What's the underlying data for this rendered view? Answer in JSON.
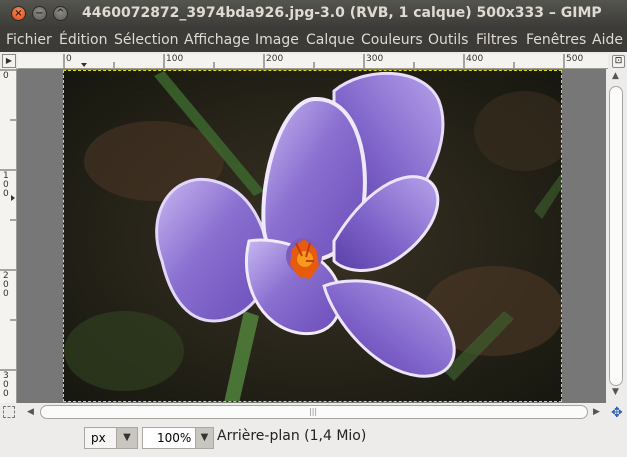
{
  "window": {
    "title": "4460072872_3974bda926.jpg-3.0 (RVB, 1 calque) 500x333 – GIMP",
    "close_glyph": "×",
    "minimize_glyph": "−",
    "maximize_glyph": "^"
  },
  "menu": {
    "items": [
      "Fichier",
      "Édition",
      "Sélection",
      "Affichage",
      "Image",
      "Calque",
      "Couleurs",
      "Outils",
      "Filtres",
      "Fenêtres",
      "Aide"
    ]
  },
  "rulers": {
    "top_labels": [
      "0",
      "100",
      "200",
      "300",
      "400",
      "500"
    ],
    "left_labels": [
      "0",
      "100",
      "200",
      "300"
    ]
  },
  "status": {
    "unit": "px",
    "zoom": "100%",
    "layer_info": "Arrière-plan (1,4 Mio)"
  },
  "icons": {
    "close": "close-icon",
    "minimize": "minimize-icon",
    "maximize": "maximize-icon",
    "navigate": "navigate-icon",
    "quick_mask": "quick-mask-icon",
    "zoom_toggle": "zoom-toggle-icon"
  },
  "colors": {
    "accent": "#d84a14",
    "titlebar": "#3c3b37",
    "selection_outline": "#e5e000",
    "petal": "#8a6fd0"
  }
}
